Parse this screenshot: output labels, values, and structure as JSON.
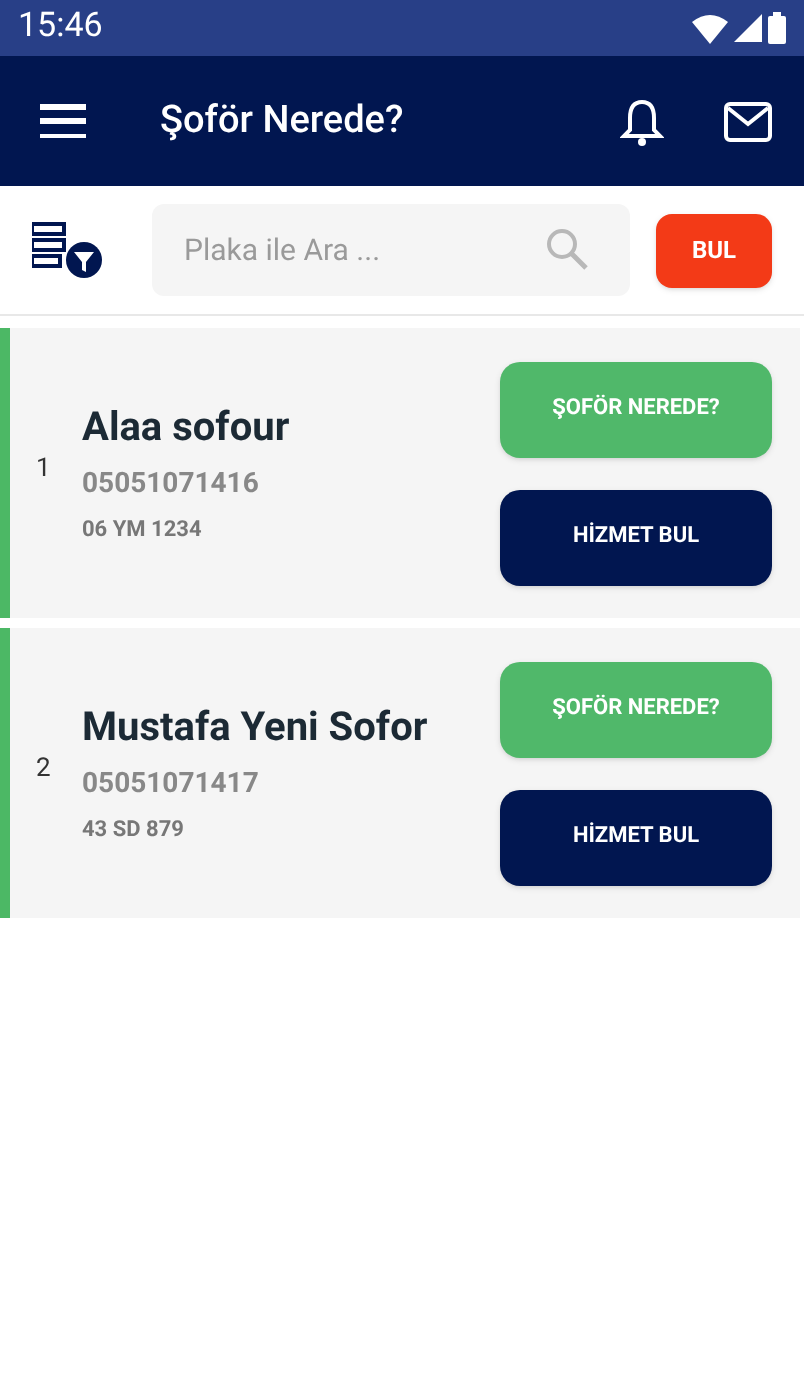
{
  "status_bar": {
    "time": "15:46"
  },
  "app_bar": {
    "title": "Şoför Nerede?"
  },
  "search": {
    "placeholder": "Plaka ile Ara ...",
    "button": "BUL"
  },
  "drivers": [
    {
      "index": "1",
      "name": "Alaa sofour",
      "phone": "05051071416",
      "plate": "06 YM 1234",
      "locate_button": "ŞOFÖR NEREDE?",
      "service_button": "HİZMET BUL"
    },
    {
      "index": "2",
      "name": "Mustafa Yeni Sofor",
      "phone": "05051071417",
      "plate": "43 SD 879",
      "locate_button": "ŞOFÖR NEREDE?",
      "service_button": "HİZMET BUL"
    }
  ]
}
